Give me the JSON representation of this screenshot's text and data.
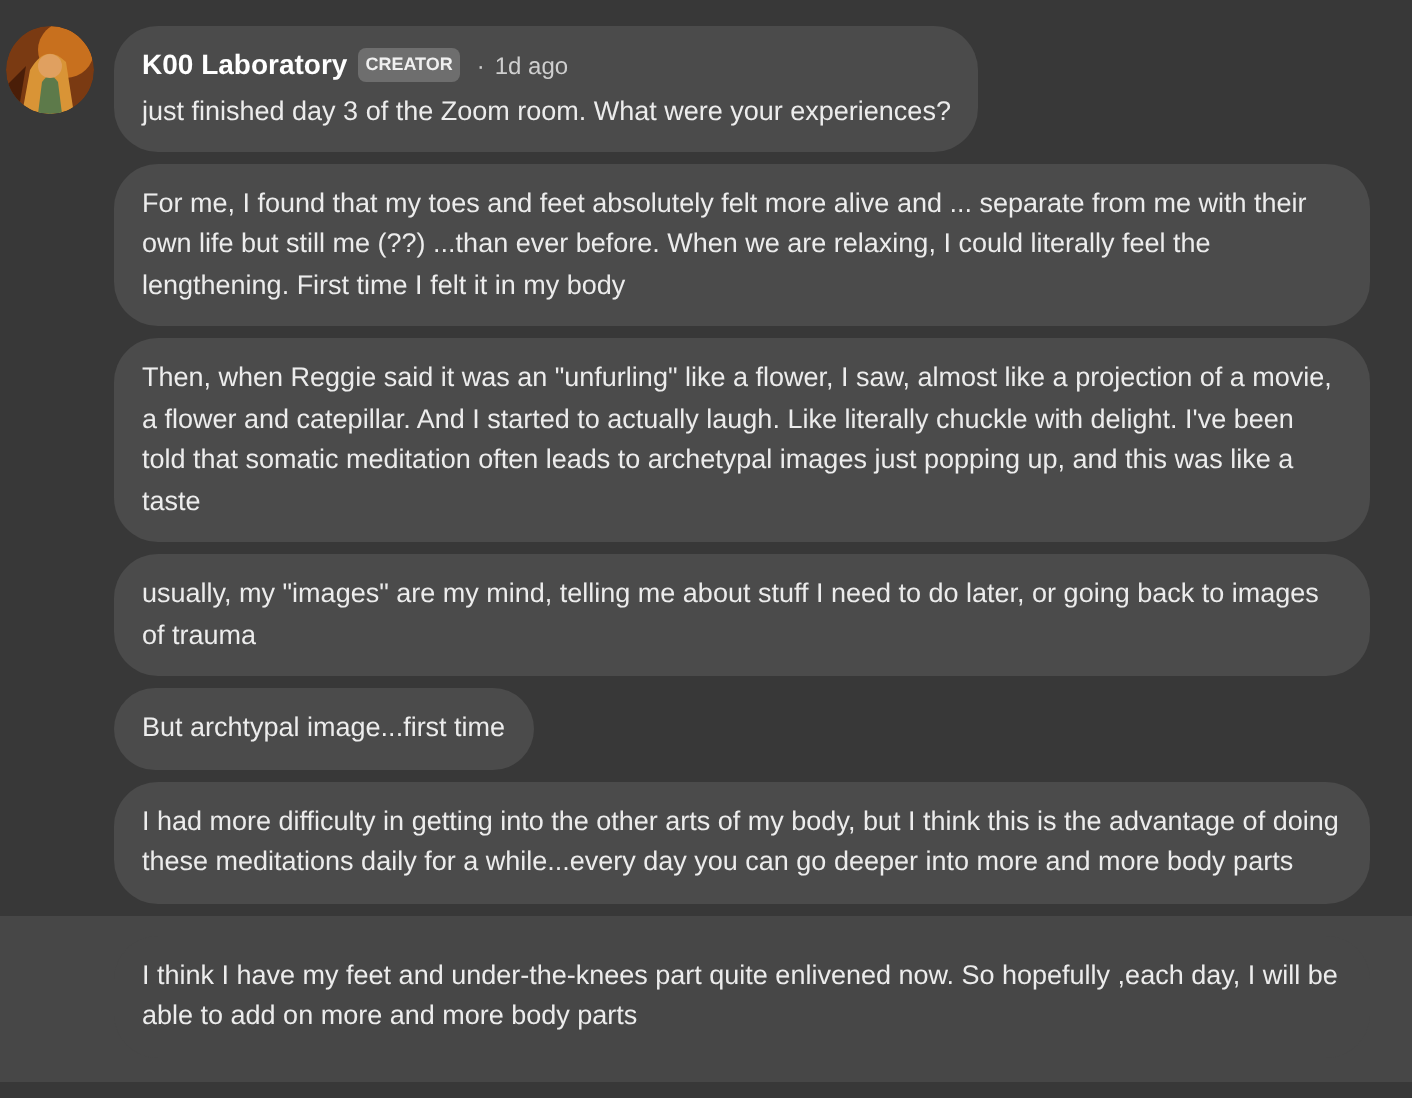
{
  "post": {
    "author": "K00 Laboratory",
    "badge": "CREATOR",
    "separator": "·",
    "time": "1d ago",
    "messages": [
      {
        "text": "just finished day 3 of the Zoom room. What were your experiences?",
        "highlighted": false
      },
      {
        "text": "For me, I found that my toes and feet absolutely felt more alive and ... separate from me with their own life but still me (??) ...than ever before. When we are relaxing, I could literally feel the lengthening. First time I felt it in my body",
        "highlighted": false
      },
      {
        "text": "Then, when Reggie said it was an \"unfurling\" like a flower, I saw, almost like a projection of a movie, a flower and catepillar. And I started to actually laugh. Like literally chuckle with delight. I've been told that somatic meditation often leads to archetypal images just popping up, and this was like a taste",
        "highlighted": false
      },
      {
        "text": "usually, my \"images\" are my mind, telling me about stuff I need to do later, or going back to images of trauma",
        "highlighted": false
      },
      {
        "text": "But archtypal image...first time",
        "highlighted": false
      },
      {
        "text": "I had more difficulty in getting into the other arts of my body, but I think this is the advantage of doing these meditations daily for a while...every day you can go deeper into more and more body parts",
        "highlighted": false
      },
      {
        "text": "I think I have my feet and under-the-knees part quite enlivened now. So hopefully ,each day, I will be able to add on more and more body parts",
        "highlighted": true
      }
    ]
  }
}
